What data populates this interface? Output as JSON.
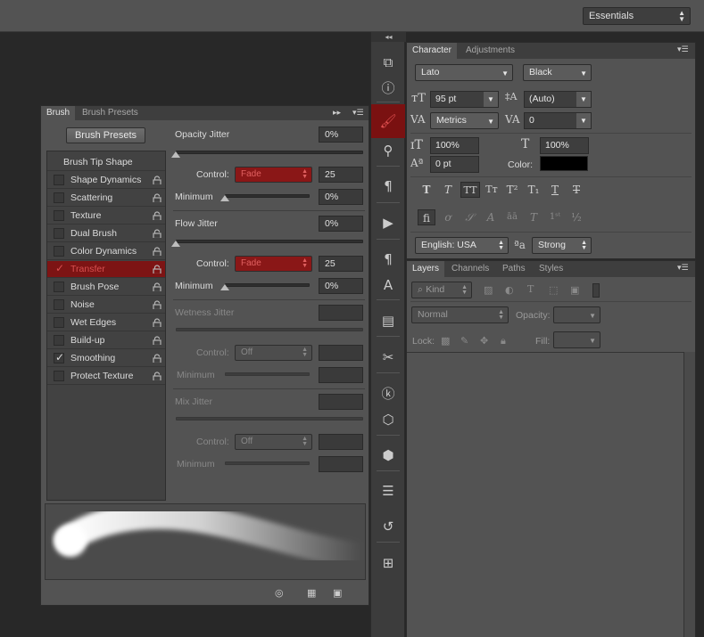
{
  "topbar": {
    "workspace": "Essentials"
  },
  "brush_panel": {
    "tabs": [
      "Brush",
      "Brush Presets"
    ],
    "presets_button": "Brush Presets",
    "tip_items": [
      {
        "label": "Brush Tip Shape",
        "checkbox": false,
        "header": true
      },
      {
        "label": "Shape Dynamics",
        "checked": false
      },
      {
        "label": "Scattering",
        "checked": false
      },
      {
        "label": "Texture",
        "checked": false
      },
      {
        "label": "Dual Brush",
        "checked": false
      },
      {
        "label": "Color Dynamics",
        "checked": false
      },
      {
        "label": "Transfer",
        "checked": true,
        "selected": true
      },
      {
        "label": "Brush Pose",
        "checked": false
      },
      {
        "label": "Noise",
        "checked": false
      },
      {
        "label": "Wet Edges",
        "checked": false
      },
      {
        "label": "Build-up",
        "checked": false
      },
      {
        "label": "Smoothing",
        "checked": true
      },
      {
        "label": "Protect Texture",
        "checked": false
      }
    ],
    "opacity_jitter": {
      "label": "Opacity Jitter",
      "value": "0%",
      "control_label": "Control:",
      "control": "Fade",
      "control_value": "25",
      "min_label": "Minimum",
      "min_value": "0%"
    },
    "flow_jitter": {
      "label": "Flow Jitter",
      "value": "0%",
      "control_label": "Control:",
      "control": "Fade",
      "control_value": "25",
      "min_label": "Minimum",
      "min_value": "0%"
    },
    "wetness_jitter": {
      "label": "Wetness Jitter",
      "control_label": "Control:",
      "control": "Off",
      "min_label": "Minimum"
    },
    "mix_jitter": {
      "label": "Mix Jitter",
      "control_label": "Control:",
      "control": "Off",
      "min_label": "Minimum"
    }
  },
  "character_panel": {
    "tabs": [
      "Character",
      "Adjustments"
    ],
    "font_family": "Lato",
    "font_style": "Black",
    "font_size": "95 pt",
    "leading": "(Auto)",
    "kerning": "Metrics",
    "tracking": "0",
    "vertical_scale": "100%",
    "horizontal_scale": "100%",
    "baseline_shift": "0 pt",
    "color_label": "Color:",
    "color_value": "#000000",
    "language": "English: USA",
    "antialias": "Strong"
  },
  "layers_panel": {
    "tabs": [
      "Layers",
      "Channels",
      "Paths",
      "Styles"
    ],
    "filter_kind": "Kind",
    "blend_mode": "Normal",
    "opacity_label": "Opacity:",
    "lock_label": "Lock:",
    "fill_label": "Fill:"
  }
}
